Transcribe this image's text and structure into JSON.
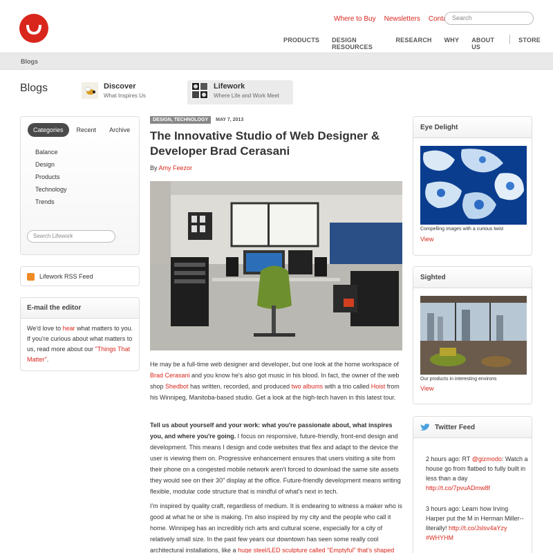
{
  "header": {
    "utility_links": [
      "Where to Buy",
      "Newsletters",
      "Contact"
    ],
    "search_placeholder": "Search",
    "nav": [
      "PRODUCTS",
      "DESIGN RESOURCES",
      "RESEARCH",
      "WHY",
      "ABOUT US",
      "STORE"
    ]
  },
  "breadcrumb": "Blogs",
  "blogs": {
    "title": "Blogs",
    "tabs": [
      {
        "title": "Discover",
        "subtitle": "What Inspires Us"
      },
      {
        "title": "Lifework",
        "subtitle": "Where Life and Work Meet"
      }
    ]
  },
  "sidebar": {
    "tabs": [
      "Categories",
      "Recent",
      "Archive"
    ],
    "categories": [
      "Balance",
      "Design",
      "Products",
      "Technology",
      "Trends"
    ],
    "search_placeholder": "Search Lifework",
    "rss_label": "Lifework RSS Feed",
    "email": {
      "title": "E-mail the editor",
      "body_pre": "We'd love to ",
      "body_link": "hear",
      "body_mid": " what matters to you. If you're curious about what matters to us, read more about our ",
      "body_link2": "\"Things That Matter\"",
      "body_post": "."
    }
  },
  "article": {
    "tag": "DESIGN, TECHNOLOGY",
    "date": "MAY 7, 2013",
    "title": "The Innovative Studio of Web Designer & Developer Brad Cerasani",
    "by": "By ",
    "author": "Amy Feezor",
    "p1": {
      "a": "He may be a full-time web designer and developer, but one look at the home workspace of ",
      "l1": "Brad Cerasani",
      "b": " and you know he's also got music in his blood. In fact, the owner of the web shop ",
      "l2": "Shedbot",
      "c": " has written, recorded, and produced ",
      "l3": "two albums",
      "d": " with a trio called ",
      "l4": "Hoist",
      "e": " from his Winnipeg, Manitoba-based studio. Get a look at the high-tech haven in this latest tour."
    },
    "p2": {
      "bold": "Tell us about yourself and your work: what you're passionate about, what inspires you, and where you're going.",
      "text": " I focus on responsive, future-friendly, front-end design and development. This means I design and code websites that flex and adapt to the device the user is viewing them on. Progressive enhancement ensures that users visiting a site from their phone on a congested mobile network aren't forced to download the same site assets they would see on their 30\" display at the office. Future-friendly development means writing flexible, modular code structure that is mindful of what's next in tech."
    },
    "p3": {
      "a": "I'm inspired by quality craft, regardless of medium. It is endearing to witness a maker who is good at what he or she is making. I'm also inspired by my city and the people who call it home. Winnipeg has an incredibly rich arts and cultural scene, especially for a city of relatively small size. In the past few years our downtown has seen some really cool architectural installations, like a ",
      "l1": "huge steel/LED sculpture called \"Emptyful\" that's shaped"
    }
  },
  "right": {
    "eye": {
      "title": "Eye Delight",
      "caption": "Compelling images with a curious twist",
      "link": "View"
    },
    "sighted": {
      "title": "Sighted",
      "caption": "Our products in interesting environs",
      "link": "View"
    },
    "twitter": {
      "title": "Twitter Feed",
      "tweets": [
        {
          "time": "2 hours ago: RT ",
          "handle": "@gizmodo",
          "text": ": Watch a house go from flatbed to fully built in less than a day ",
          "url": "http://t.co/7pvuADmw8f"
        },
        {
          "time": "3 hours ago: ",
          "handle": "",
          "text": "Learn how Irving Harper put the M in Herman Miller--literally! ",
          "url": "http://t.co/Jslsv4aYzy",
          "tag": " #WHYHM"
        }
      ]
    }
  },
  "colors": {
    "accent": "#d9261c",
    "rss": "#f08a24",
    "twitter": "#4aa3df"
  }
}
